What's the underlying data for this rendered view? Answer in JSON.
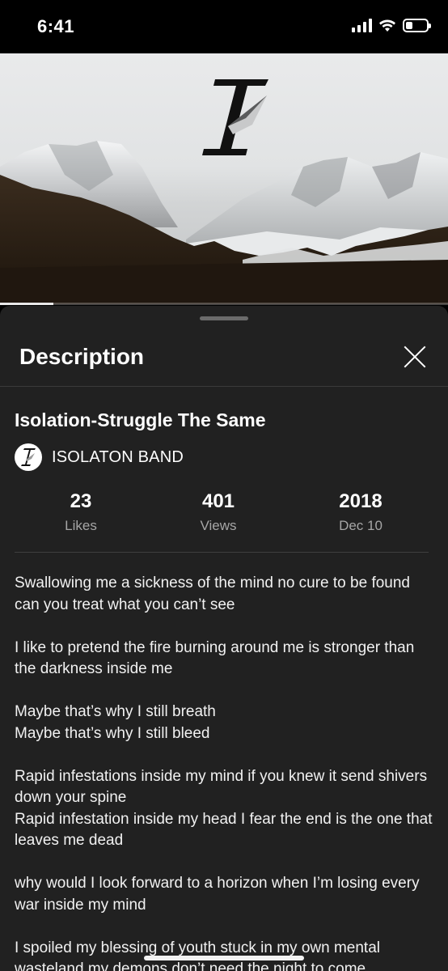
{
  "status_bar": {
    "time": "6:41"
  },
  "banner": {
    "logo": "I-stylized-logo"
  },
  "progress": {
    "fraction": 0.12
  },
  "sheet": {
    "title": "Description"
  },
  "video": {
    "title": "Isolation-Struggle The Same",
    "channel": "ISOLATON BAND"
  },
  "stats": [
    {
      "value": "23",
      "label": "Likes"
    },
    {
      "value": "401",
      "label": "Views"
    },
    {
      "value": "2018",
      "label": "Dec 10"
    }
  ],
  "lyrics": [
    [
      "Swallowing me a sickness of the mind no cure to be found can you treat what you can’t see"
    ],
    [
      "I like to pretend the fire burning around me is stronger than the darkness inside me"
    ],
    [
      "Maybe that’s why I still breath",
      "Maybe that’s why I still bleed"
    ],
    [
      "Rapid infestations inside my mind if you knew it send shivers down your spine",
      "Rapid infestation inside my head I fear the end is the one that leaves me dead"
    ],
    [
      "why would I look forward to a horizon when I’m losing every war inside my mind"
    ],
    [
      "I spoiled my blessing of youth stuck in my own mental wasteland my demons don’t need the night to come"
    ]
  ],
  "icons": {
    "close": "close-icon",
    "signal": "signal-icon",
    "wifi": "wifi-icon",
    "battery": "battery-icon"
  },
  "colors": {
    "sheet_bg": "#212121",
    "secondary_text": "#a6a6a6"
  }
}
